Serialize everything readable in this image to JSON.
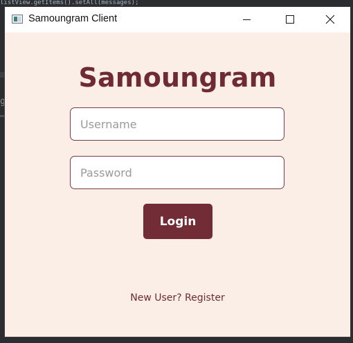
{
  "background_ide": {
    "code_snippet": "listView.getItems().setAll(messages);",
    "side_glyph": "g"
  },
  "window": {
    "title": "Samoungram Client",
    "app_icon": "window-app-icon",
    "controls": {
      "minimize_icon": "minimize-icon",
      "maximize_icon": "maximize-icon",
      "close_icon": "close-icon"
    }
  },
  "login_form": {
    "heading": "Samoungram",
    "username_placeholder": "Username",
    "username_value": "",
    "password_placeholder": "Password",
    "password_value": "",
    "login_label": "Login",
    "register_link": "New User? Register"
  },
  "colors": {
    "accent": "#722c36",
    "heading": "#6e2a35",
    "window_background": "#faeee6",
    "titlebar": "#ffffff"
  }
}
